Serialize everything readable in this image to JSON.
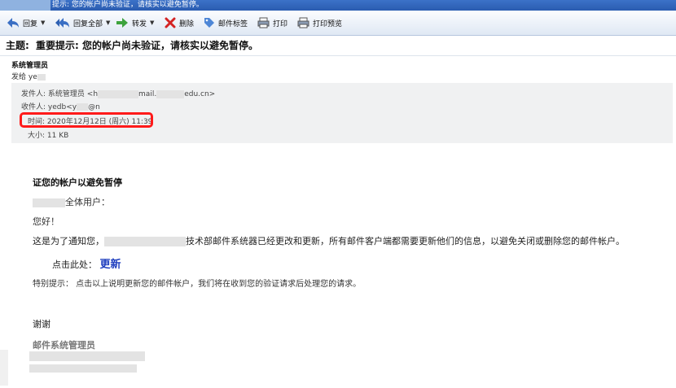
{
  "titlebar": {
    "text": "提示: 您的帐户尚未验证，请核实以避免暂停。"
  },
  "toolbar": {
    "reply": "回复",
    "reply_all": "回复全部",
    "forward": "转发",
    "delete": "删除",
    "tags": "邮件标签",
    "print": "打印",
    "print_preview": "打印预览",
    "dropdown": "▼"
  },
  "subject": {
    "label": "主题:",
    "value": "重要提示: 您的帐户尚未验证，请核实以避免暂停。"
  },
  "sender": {
    "name": "系统管理员",
    "to_label": "发给",
    "to_value": "ye"
  },
  "headers": {
    "from_label": "发件人:",
    "from_name": "系统管理员 <h",
    "from_mid": "mail.",
    "from_tail": "edu.cn>",
    "to_label": "收件人:",
    "to_name": "yedb<y",
    "to_tail": "@n",
    "time_label": "时间:",
    "time_value": "2020年12月12日 (周六) 11:39",
    "size_label": "大小:",
    "size_value": "11 KB"
  },
  "body": {
    "heading": "证您的帐户以避免暂停",
    "greeting_tail": "全体用户：",
    "hello": "您好！",
    "notice_head": "这是为了通知您，",
    "notice_tail": "技术部邮件系统器已经更改和更新，所有邮件客户端都需要更新他们的信息，以避免关闭或删除您的邮件帐户。",
    "click_label": "点击此处：",
    "update_link": "更新",
    "special": "特别提示：  点击以上说明更新您的邮件帐户，我们将在收到您的验证请求后处理您的请求。",
    "thanks": "谢谢",
    "signature": "邮件系统管理员"
  }
}
